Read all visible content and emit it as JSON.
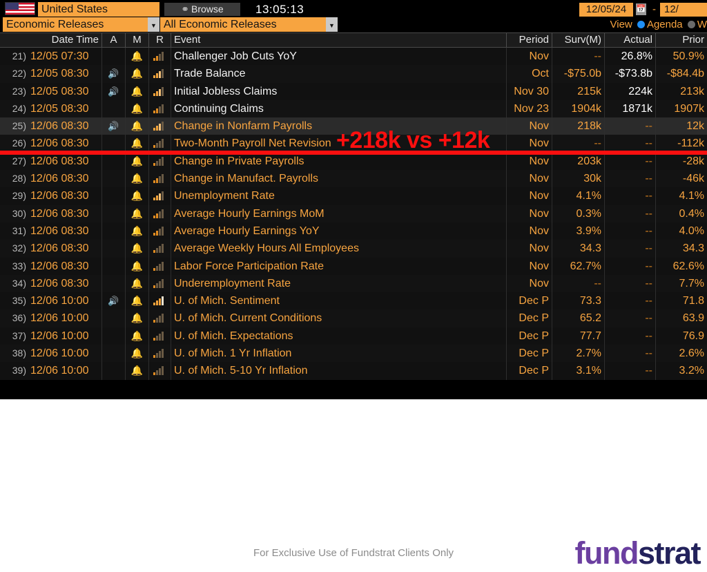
{
  "toolbar": {
    "flag_icon": "us-flag-icon",
    "country": "United States",
    "browse_label": "Browse",
    "browse_icon": "browse-icon",
    "clock": "13:05:13",
    "date_start": "12/05/24",
    "calendar_icon": "calendar-icon",
    "date_separator": "-",
    "date_end": "12/",
    "category": "Economic Releases",
    "subcategory": "All Economic Releases",
    "view_label": "View",
    "view_option_agenda": "Agenda",
    "view_option_weekly": "W",
    "dropdown_icon": "chevron-down-icon"
  },
  "columns": {
    "num": "",
    "date_time": "Date Time",
    "a": "A",
    "m": "M",
    "r": "R",
    "event": "Event",
    "period": "Period",
    "survey": "Surv(M)",
    "actual": "Actual",
    "prior": "Prior"
  },
  "annotation": {
    "text": "+218k vs +12k",
    "color": "#fb0f0f"
  },
  "colors": {
    "amber": "#f7a440",
    "white": "#ffffff",
    "background": "#000000",
    "highlight_row": "#2b2b2b",
    "logo_purple": "#6b3fa0",
    "logo_navy": "#23225b"
  },
  "footer": {
    "note": "For Exclusive Use of Fundstrat Clients Only",
    "logo_part1": "fund",
    "logo_part2": "strat"
  },
  "rows": [
    {
      "num": "21)",
      "date": "12/05 07:30",
      "alert": false,
      "bell": true,
      "relevance": 2,
      "event": "Challenger Job Cuts YoY",
      "event_style": "white",
      "period": "Nov",
      "survey": "--",
      "actual": "26.8%",
      "prior": "50.9%",
      "selected": false
    },
    {
      "num": "22)",
      "date": "12/05 08:30",
      "alert": true,
      "bell": true,
      "relevance": 3,
      "event": "Trade Balance",
      "event_style": "white",
      "period": "Oct",
      "survey": "-$75.0b",
      "actual": "-$73.8b",
      "prior": "-$84.4b",
      "selected": false
    },
    {
      "num": "23)",
      "date": "12/05 08:30",
      "alert": true,
      "bell": true,
      "relevance": 3,
      "event": "Initial Jobless Claims",
      "event_style": "white",
      "period": "Nov 30",
      "survey": "215k",
      "actual": "224k",
      "prior": "213k",
      "selected": false
    },
    {
      "num": "24)",
      "date": "12/05 08:30",
      "alert": false,
      "bell": true,
      "relevance": 2,
      "event": "Continuing Claims",
      "event_style": "white",
      "period": "Nov 23",
      "survey": "1904k",
      "actual": "1871k",
      "prior": "1907k",
      "selected": false
    },
    {
      "num": "25)",
      "date": "12/06 08:30",
      "alert": true,
      "bell": true,
      "relevance": 3,
      "event": "Change in Nonfarm Payrolls",
      "event_style": "amber",
      "period": "Nov",
      "survey": "218k",
      "actual": "--",
      "prior": "12k",
      "selected": true
    },
    {
      "num": "26)",
      "date": "12/06 08:30",
      "alert": false,
      "bell": true,
      "relevance": 1,
      "event": "Two-Month Payroll Net Revision",
      "event_style": "amber",
      "period": "Nov",
      "survey": "--",
      "actual": "--",
      "prior": "-112k",
      "selected": false
    },
    {
      "num": "27)",
      "date": "12/06 08:30",
      "alert": false,
      "bell": true,
      "relevance": 1,
      "event": "Change in Private Payrolls",
      "event_style": "amber",
      "period": "Nov",
      "survey": "203k",
      "actual": "--",
      "prior": "-28k",
      "selected": false
    },
    {
      "num": "28)",
      "date": "12/06 08:30",
      "alert": false,
      "bell": true,
      "relevance": 2,
      "event": "Change in Manufact. Payrolls",
      "event_style": "amber",
      "period": "Nov",
      "survey": "30k",
      "actual": "--",
      "prior": "-46k",
      "selected": false
    },
    {
      "num": "29)",
      "date": "12/06 08:30",
      "alert": false,
      "bell": true,
      "relevance": 3,
      "event": "Unemployment Rate",
      "event_style": "amber",
      "period": "Nov",
      "survey": "4.1%",
      "actual": "--",
      "prior": "4.1%",
      "selected": false
    },
    {
      "num": "30)",
      "date": "12/06 08:30",
      "alert": false,
      "bell": true,
      "relevance": 2,
      "event": "Average Hourly Earnings MoM",
      "event_style": "amber",
      "period": "Nov",
      "survey": "0.3%",
      "actual": "--",
      "prior": "0.4%",
      "selected": false
    },
    {
      "num": "31)",
      "date": "12/06 08:30",
      "alert": false,
      "bell": true,
      "relevance": 2,
      "event": "Average Hourly Earnings YoY",
      "event_style": "amber",
      "period": "Nov",
      "survey": "3.9%",
      "actual": "--",
      "prior": "4.0%",
      "selected": false
    },
    {
      "num": "32)",
      "date": "12/06 08:30",
      "alert": false,
      "bell": true,
      "relevance": 1,
      "event": "Average Weekly Hours All Employees",
      "event_style": "amber",
      "period": "Nov",
      "survey": "34.3",
      "actual": "--",
      "prior": "34.3",
      "selected": false
    },
    {
      "num": "33)",
      "date": "12/06 08:30",
      "alert": false,
      "bell": true,
      "relevance": 1,
      "event": "Labor Force Participation Rate",
      "event_style": "amber",
      "period": "Nov",
      "survey": "62.7%",
      "actual": "--",
      "prior": "62.6%",
      "selected": false
    },
    {
      "num": "34)",
      "date": "12/06 08:30",
      "alert": false,
      "bell": true,
      "relevance": 1,
      "event": "Underemployment Rate",
      "event_style": "amber",
      "period": "Nov",
      "survey": "--",
      "actual": "--",
      "prior": "7.7%",
      "selected": false
    },
    {
      "num": "35)",
      "date": "12/06 10:00",
      "alert": true,
      "bell": true,
      "relevance": 4,
      "event": "U. of Mich. Sentiment",
      "event_style": "amber",
      "period": "Dec P",
      "survey": "73.3",
      "actual": "--",
      "prior": "71.8",
      "selected": false
    },
    {
      "num": "36)",
      "date": "12/06 10:00",
      "alert": false,
      "bell": true,
      "relevance": 1,
      "event": "U. of Mich. Current Conditions",
      "event_style": "amber",
      "period": "Dec P",
      "survey": "65.2",
      "actual": "--",
      "prior": "63.9",
      "selected": false
    },
    {
      "num": "37)",
      "date": "12/06 10:00",
      "alert": false,
      "bell": true,
      "relevance": 1,
      "event": "U. of Mich. Expectations",
      "event_style": "amber",
      "period": "Dec P",
      "survey": "77.7",
      "actual": "--",
      "prior": "76.9",
      "selected": false
    },
    {
      "num": "38)",
      "date": "12/06 10:00",
      "alert": false,
      "bell": true,
      "relevance": 1,
      "event": "U. of Mich. 1 Yr Inflation",
      "event_style": "amber",
      "period": "Dec P",
      "survey": "2.7%",
      "actual": "--",
      "prior": "2.6%",
      "selected": false
    },
    {
      "num": "39)",
      "date": "12/06 10:00",
      "alert": false,
      "bell": true,
      "relevance": 1,
      "event": "U. of Mich. 5-10 Yr Inflation",
      "event_style": "amber",
      "period": "Dec P",
      "survey": "3.1%",
      "actual": "--",
      "prior": "3.2%",
      "selected": false
    }
  ]
}
